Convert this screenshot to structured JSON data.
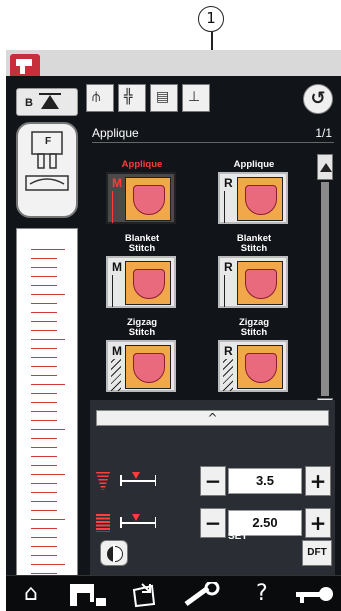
{
  "callout_number": "1",
  "sidebar": {
    "b_button_label": "B"
  },
  "foot": {
    "letter": "F"
  },
  "toolbar": {
    "icons": [
      "presser-foot-icon",
      "stitch-width-icon",
      "stitch-length-icon",
      "needle-position-icon"
    ],
    "back_label": "↺"
  },
  "pattern_header": {
    "name": "Applique",
    "page": "1/1"
  },
  "patterns": [
    {
      "caption": "Applique",
      "letter": "M",
      "stitch": "straight",
      "selected": true
    },
    {
      "caption": "Applique",
      "letter": "R",
      "stitch": "straight",
      "selected": false
    },
    {
      "caption": "Blanket\nStitch",
      "letter": "M",
      "stitch": "straight",
      "selected": false
    },
    {
      "caption": "Blanket\nStitch",
      "letter": "R",
      "stitch": "straight",
      "selected": false
    },
    {
      "caption": "Zigzag\nStitch",
      "letter": "M",
      "stitch": "zigzag",
      "selected": false
    },
    {
      "caption": "Zigzag\nStitch",
      "letter": "R",
      "stitch": "zigzag",
      "selected": false
    }
  ],
  "adjust": {
    "caret": "^",
    "width_value": "3.5",
    "length_value": "2.50",
    "minus": "−",
    "plus": "+"
  },
  "dft_label": "DFT",
  "bottom_bar": {
    "home": "home-icon",
    "machine": "sewing-machine-icon",
    "save": "save-file-icon",
    "set_label": "SET",
    "help": "?",
    "lock": "key-icon"
  },
  "colors": {
    "screen_bg": "#111419",
    "accent_red": "#ff3b3b",
    "applique_fill": "#f0a84a",
    "tulip_fill": "#e86a7c"
  }
}
